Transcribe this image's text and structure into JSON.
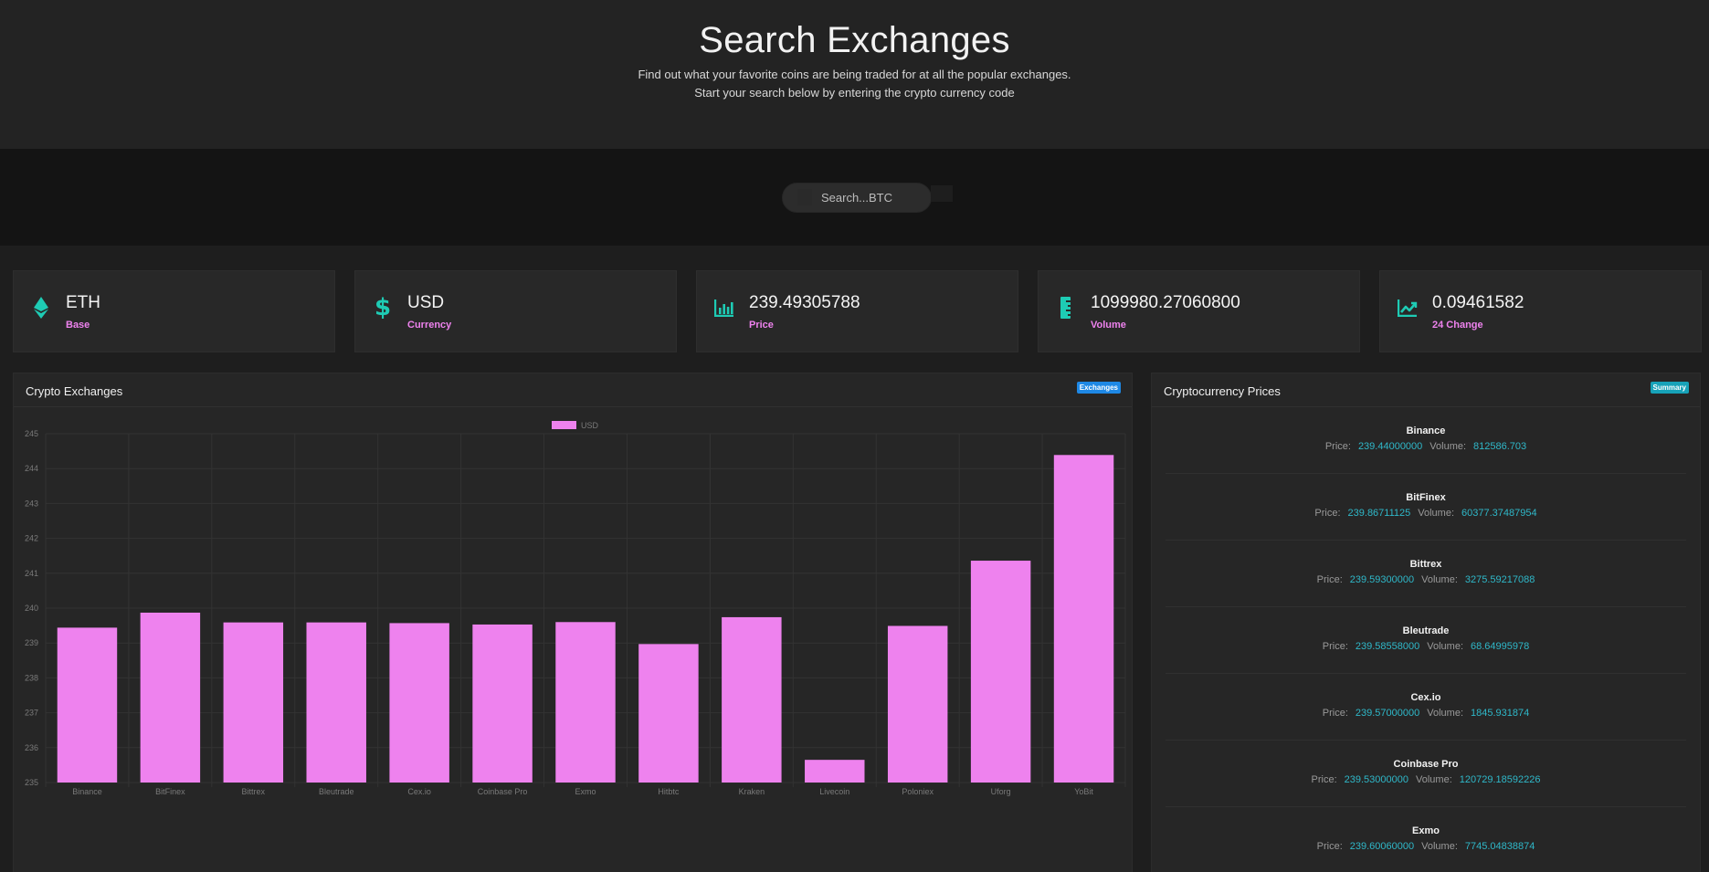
{
  "hero": {
    "title": "Search Exchanges",
    "subtitle1": "Find out what your favorite coins are being traded for at all the popular exchanges.",
    "subtitle2": "Start your search below by entering the crypto currency code"
  },
  "search": {
    "placeholder": "Search...BTC"
  },
  "stats": [
    {
      "icon": "ethereum-icon",
      "value": "ETH",
      "label": "Base"
    },
    {
      "icon": "dollar-icon",
      "value": "USD",
      "label": "Currency"
    },
    {
      "icon": "bar-chart-icon",
      "value": "239.49305788",
      "label": "Price"
    },
    {
      "icon": "ruler-icon",
      "value": "1099980.27060800",
      "label": "Volume"
    },
    {
      "icon": "trend-chart-icon",
      "value": "0.09461582",
      "label": "24 Change"
    }
  ],
  "exchanges_panel": {
    "title": "Crypto Exchanges",
    "badge": "Exchanges",
    "badge_color": "#1e88e5"
  },
  "prices_panel": {
    "title": "Cryptocurrency Prices",
    "badge": "Summary",
    "badge_color": "#17a2b8",
    "price_label": "Price:",
    "volume_label": "Volume:",
    "items": [
      {
        "name": "Binance",
        "price": "239.44000000",
        "volume": "812586.703"
      },
      {
        "name": "BitFinex",
        "price": "239.86711125",
        "volume": "60377.37487954"
      },
      {
        "name": "Bittrex",
        "price": "239.59300000",
        "volume": "3275.59217088"
      },
      {
        "name": "Bleutrade",
        "price": "239.58558000",
        "volume": "68.64995978"
      },
      {
        "name": "Cex.io",
        "price": "239.57000000",
        "volume": "1845.931874"
      },
      {
        "name": "Coinbase Pro",
        "price": "239.53000000",
        "volume": "120729.18592226"
      },
      {
        "name": "Exmo",
        "price": "239.60060000",
        "volume": "7745.04838874"
      }
    ]
  },
  "accent_colors": {
    "teal": "#1ecbb4",
    "pink": "#ee82ee",
    "link": "#2fb8c9"
  },
  "chart_data": {
    "type": "bar",
    "categories": [
      "Binance",
      "BitFinex",
      "Bittrex",
      "Bleutrade",
      "Cex.io",
      "Coinbase Pro",
      "Exmo",
      "Hitbtc",
      "Kraken",
      "Livecoin",
      "Poloniex",
      "Uforg",
      "YoBit"
    ],
    "series": [
      {
        "name": "USD",
        "color": "#ee82ee",
        "values": [
          239.44,
          239.87,
          239.59,
          239.59,
          239.57,
          239.53,
          239.6,
          238.97,
          239.74,
          235.65,
          239.49,
          241.36,
          244.39
        ]
      }
    ],
    "yticks": [
      "235",
      "236",
      "237",
      "238",
      "239",
      "240",
      "241",
      "242",
      "243",
      "244",
      "245"
    ],
    "ylim": [
      235,
      245
    ],
    "grid": true,
    "legend": "top-center",
    "title": "",
    "xlabel": "",
    "ylabel": ""
  }
}
